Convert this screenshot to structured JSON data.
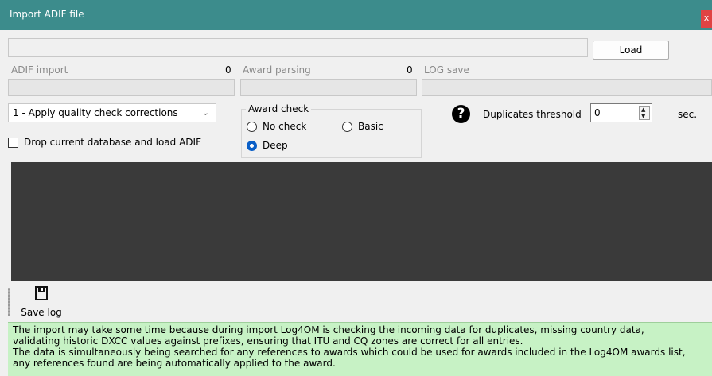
{
  "window": {
    "title": "Import ADIF file",
    "close_label": "x"
  },
  "file": {
    "path_value": "",
    "load_label": "Load"
  },
  "progress": [
    {
      "label": "ADIF import",
      "count": "0"
    },
    {
      "label": "Award parsing",
      "count": "0"
    },
    {
      "label": "LOG save",
      "count": ""
    }
  ],
  "options": {
    "quality_selected": "1 - Apply quality check corrections",
    "drop_db_label": "Drop current database and load ADIF",
    "drop_db_checked": false
  },
  "award_check": {
    "title": "Award check",
    "options": [
      "No check",
      "Basic",
      "Deep"
    ],
    "selected": "Deep"
  },
  "duplicates": {
    "label": "Duplicates threshold",
    "value": "0",
    "unit": "sec."
  },
  "toolbar": {
    "save_log_label": "Save log"
  },
  "info": {
    "lines": [
      "The import may take some time because during  import Log4OM is checking the incoming data for duplicates, missing country data,",
      "validating historic DXCC values against prefixes, ensuring that ITU and CQ zones are correct for all entries.",
      "The data is simultaneously being searched for any references to awards which could be used for awards included in the Log4OM awards list,",
      "any references found are being automatically applied to the award."
    ]
  },
  "colors": {
    "titlebar": "#3c8c8c",
    "log_bg": "#3a3a3a",
    "info_bg": "#c7f2c5",
    "accent": "#0a5fc7"
  }
}
